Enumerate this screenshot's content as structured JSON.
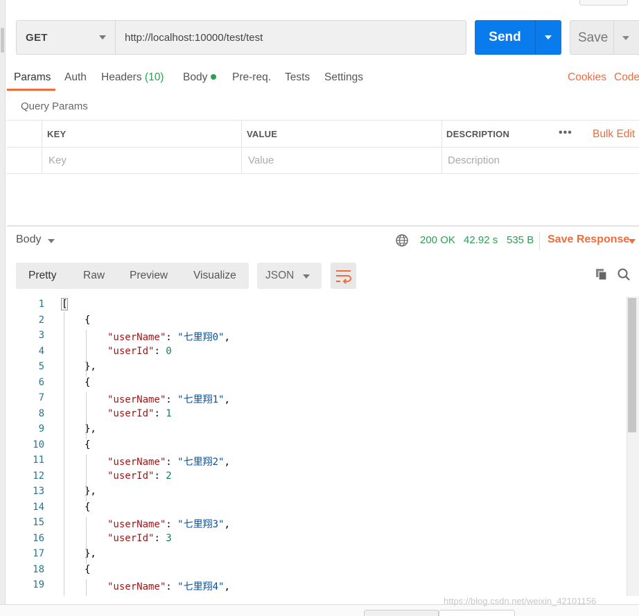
{
  "request": {
    "method": "GET",
    "url": "http://localhost:10000/test/test",
    "send_label": "Send",
    "save_label": "Save"
  },
  "tabs": {
    "params": "Params",
    "auth": "Auth",
    "headers": "Headers",
    "headers_count": "(10)",
    "body": "Body",
    "prereq": "Pre-req.",
    "tests": "Tests",
    "settings": "Settings",
    "cookies": "Cookies",
    "code": "Code"
  },
  "query_params": {
    "title": "Query Params",
    "columns": {
      "key": "KEY",
      "value": "VALUE",
      "description": "DESCRIPTION"
    },
    "more": "•••",
    "bulk_edit": "Bulk Edit",
    "placeholders": {
      "key": "Key",
      "value": "Value",
      "description": "Description"
    }
  },
  "response": {
    "body_label": "Body",
    "status": "200 OK",
    "time": "42.92 s",
    "size": "535 B",
    "save_response": "Save Response",
    "formats": [
      "Pretty",
      "Raw",
      "Preview",
      "Visualize"
    ],
    "language": "JSON"
  },
  "code_lines": [
    {
      "n": "1"
    },
    {
      "n": "2"
    },
    {
      "n": "3",
      "key": "\"userName\"",
      "val": "\"七里翔0\""
    },
    {
      "n": "4",
      "key": "\"userId\"",
      "val": "0"
    },
    {
      "n": "5"
    },
    {
      "n": "6"
    },
    {
      "n": "7",
      "key": "\"userName\"",
      "val": "\"七里翔1\""
    },
    {
      "n": "8",
      "key": "\"userId\"",
      "val": "1"
    },
    {
      "n": "9"
    },
    {
      "n": "10"
    },
    {
      "n": "11",
      "key": "\"userName\"",
      "val": "\"七里翔2\""
    },
    {
      "n": "12",
      "key": "\"userId\"",
      "val": "2"
    },
    {
      "n": "13"
    },
    {
      "n": "14"
    },
    {
      "n": "15",
      "key": "\"userName\"",
      "val": "\"七里翔3\""
    },
    {
      "n": "16",
      "key": "\"userId\"",
      "val": "3"
    },
    {
      "n": "17"
    },
    {
      "n": "18"
    },
    {
      "n": "19",
      "key": "\"userName\"",
      "val": "\"七里翔4\""
    }
  ],
  "watermark": "https://blog.csdn.net/weixin_42101156",
  "colors": {
    "accent": "#f26b3a",
    "send_blue": "#097bed",
    "success_green": "#27a253"
  }
}
